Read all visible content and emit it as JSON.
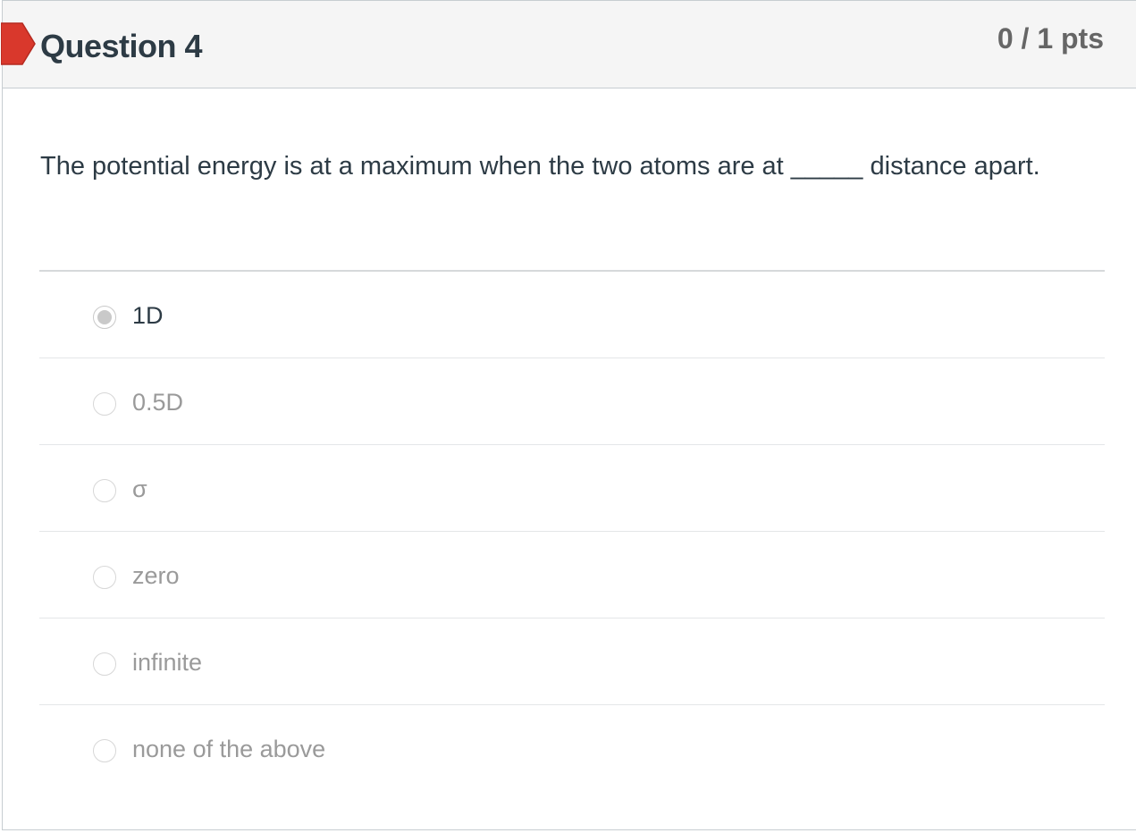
{
  "question": {
    "title": "Question 4",
    "points": "0 / 1 pts",
    "prompt": "The potential energy is at a maximum when the two atoms are at _____ distance apart."
  },
  "answers": [
    {
      "label": "1D",
      "selected": true
    },
    {
      "label": "0.5D",
      "selected": false
    },
    {
      "label": "σ",
      "selected": false
    },
    {
      "label": "zero",
      "selected": false
    },
    {
      "label": "infinite",
      "selected": false
    },
    {
      "label": "none of the above",
      "selected": false
    }
  ],
  "colors": {
    "flag": "#d9382c",
    "header_bg": "#f5f5f5",
    "title": "#2d3b45",
    "points": "#666666"
  }
}
